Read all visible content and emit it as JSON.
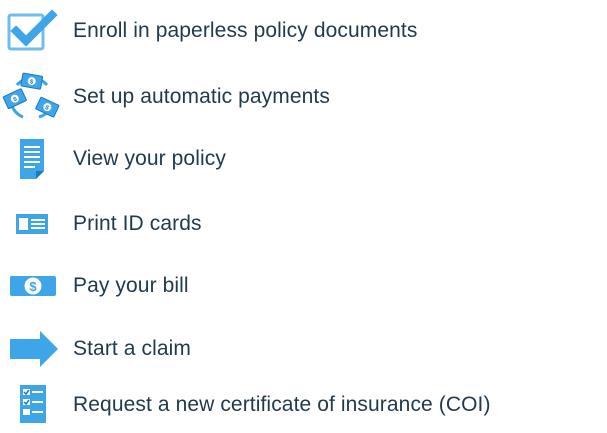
{
  "colors": {
    "text": "#1f3a4d",
    "icon_blue": "#3ea6e8",
    "icon_blue_dark": "#1c78c0",
    "icon_light": "#ffffff"
  },
  "items": [
    {
      "label": "Enroll in paperless policy documents",
      "icon": "checkbox-check-icon"
    },
    {
      "label": "Set up automatic payments",
      "icon": "recurring-money-icon"
    },
    {
      "label": "View your policy",
      "icon": "document-icon"
    },
    {
      "label": "Print ID cards",
      "icon": "id-card-icon"
    },
    {
      "label": "Pay your bill",
      "icon": "dollar-bill-icon"
    },
    {
      "label": "Start a claim",
      "icon": "arrow-right-icon"
    },
    {
      "label": "Request a new certificate of insurance (COI)",
      "icon": "checklist-certificate-icon"
    }
  ]
}
